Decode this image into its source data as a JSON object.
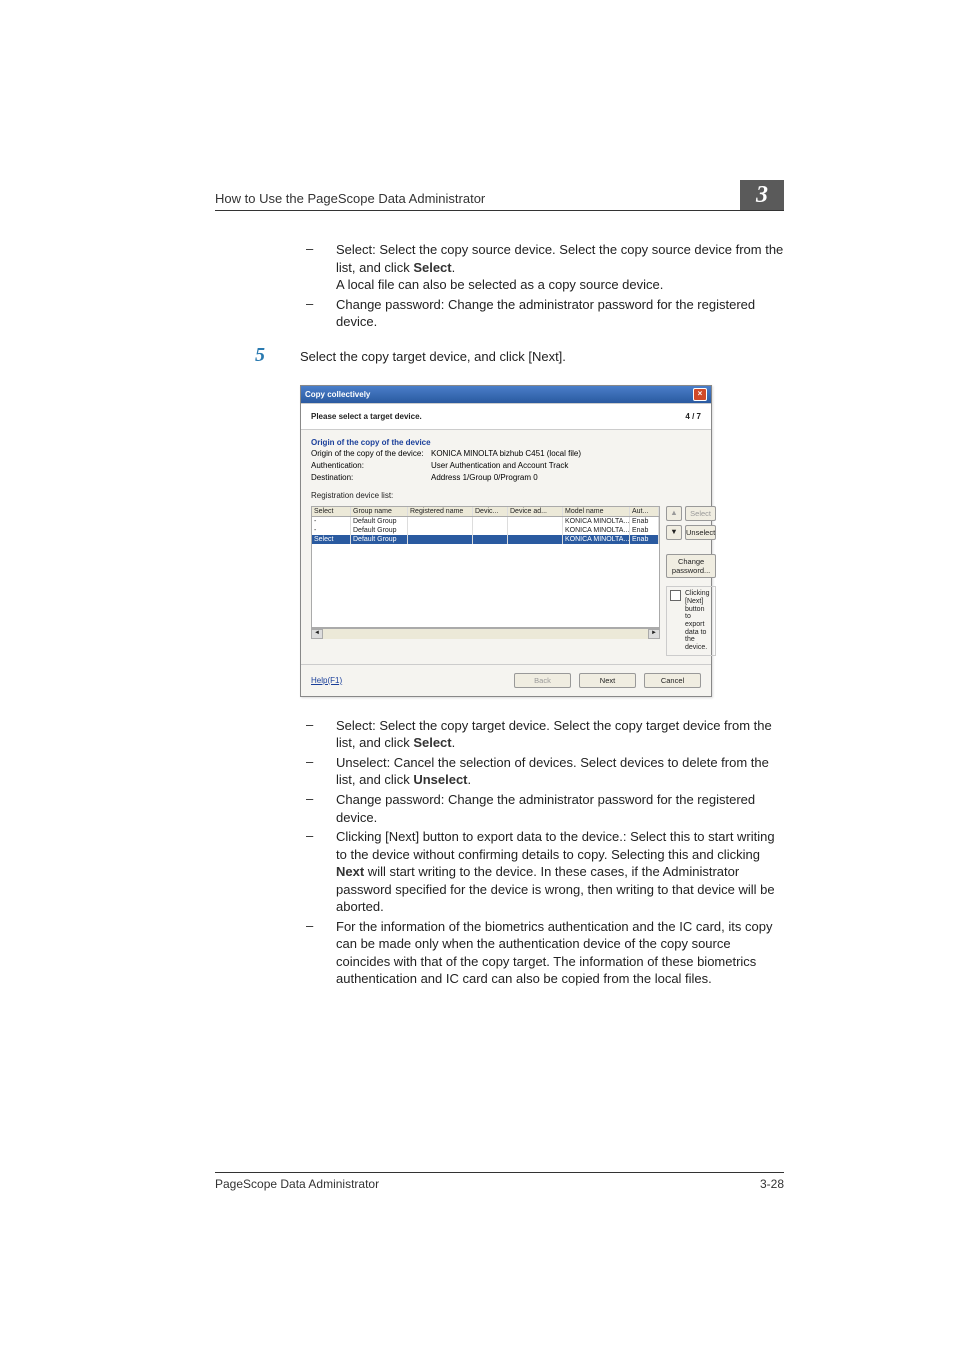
{
  "header": {
    "title": "How to Use the PageScope Data Administrator",
    "chapter": "3"
  },
  "upper_bullets": [
    {
      "lead": "Select: Select the copy source device. Select the copy source device from the list, and click ",
      "bold": "Select",
      "tail": ".\nA local file can also be selected as a copy source device."
    },
    {
      "lead": "Change password: Change the administrator password for the registered device.",
      "bold": "",
      "tail": ""
    }
  ],
  "step": {
    "num": "5",
    "text": "Select the copy target device, and click [Next]."
  },
  "dialog": {
    "title": "Copy collectively",
    "close": "×",
    "instruction": "Please select a target device.",
    "progress": "4 / 7",
    "section": "Origin of the copy of the device",
    "info": [
      {
        "label": "Origin of the copy of the device:",
        "value": "KONICA MINOLTA bizhub C451 (local file)"
      },
      {
        "label": "Authentication:",
        "value": "User Authentication and Account Track"
      },
      {
        "label": "Destination:",
        "value": "Address 1/Group 0/Program 0"
      }
    ],
    "list_label": "Registration device list:",
    "columns": [
      "Select",
      "Group name",
      "Registered name",
      "Devic...",
      "Device ad...",
      "Model name",
      "Aut..."
    ],
    "rows": [
      {
        "select": "-",
        "group": "Default Group",
        "reg": "",
        "dev": "",
        "addr": "",
        "model": "KONICA MINOLTA...",
        "auth": "Enab",
        "hl": false
      },
      {
        "select": "-",
        "group": "Default Group",
        "reg": "",
        "dev": "",
        "addr": "",
        "model": "KONICA MINOLTA...",
        "auth": "Enab",
        "hl": false
      },
      {
        "select": "Select",
        "group": "Default Group",
        "reg": "",
        "dev": "",
        "addr": "",
        "model": "KONICA MINOLTA...",
        "auth": "Enab",
        "hl": true
      }
    ],
    "side": {
      "select": "Select",
      "unselect": "Unselect",
      "change_pw": "Change password...",
      "checkbox": "Clicking [Next] button to export data to the device."
    },
    "footer": {
      "help": "Help(F1)",
      "back": "Back",
      "next": "Next",
      "cancel": "Cancel"
    }
  },
  "lower_bullets": [
    {
      "lead": "Select: Select the copy target device. Select the copy target device from the list, and click ",
      "bold": "Select",
      "tail": "."
    },
    {
      "lead": "Unselect: Cancel the selection of devices. Select devices to delete from the list, and click ",
      "bold": "Unselect",
      "tail": "."
    },
    {
      "lead": "Change password: Change the administrator password for the registered device.",
      "bold": "",
      "tail": ""
    },
    {
      "lead": "Clicking [Next] button to export data to the device.: Select this to start writing to the device without confirming details to copy. Selecting this and clicking ",
      "bold": "Next",
      "tail": " will start writing to the device. In these cases, if the Administrator password specified for the device is wrong, then writing to that device will be aborted."
    },
    {
      "lead": "For the information of the biometrics authentication and the IC card, its copy can be made only when the authentication device of the copy source coincides with that of the copy target. The information of these biometrics authentication and IC card can also be copied from the local files.",
      "bold": "",
      "tail": ""
    }
  ],
  "footer": {
    "product": "PageScope Data Administrator",
    "page": "3-28"
  }
}
